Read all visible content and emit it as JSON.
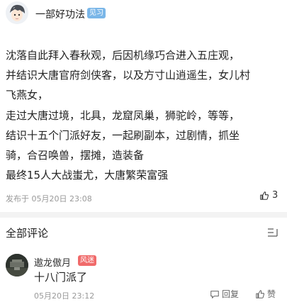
{
  "post": {
    "author": "一部好功法",
    "badge": "见习",
    "lines": [
      "沈落自此拜入春秋观，后因机缘巧合进入五庄观，",
      "并结识大唐官府剑侠客，以及方寸山逍遥生，女儿村",
      "飞燕女，",
      "走过大唐过境，北具，龙窟凤巢，狮驼岭，等等，",
      "结识十五个门派好友，一起刷副本，过剧情，抓坐",
      "骑，合召唤兽，摆摊，造装备",
      "最终15人大战蚩尤，大唐繁荣富强"
    ],
    "meta": "发布于 05月20日 23:08",
    "like_count": "3"
  },
  "comments_section": {
    "title": "全部评论"
  },
  "comment": {
    "user": "遨龙傲月",
    "tag": "风迷",
    "text": "十八门派了",
    "meta": "05月20日 23:12",
    "reply_label": "回复",
    "like_label": "赞"
  }
}
